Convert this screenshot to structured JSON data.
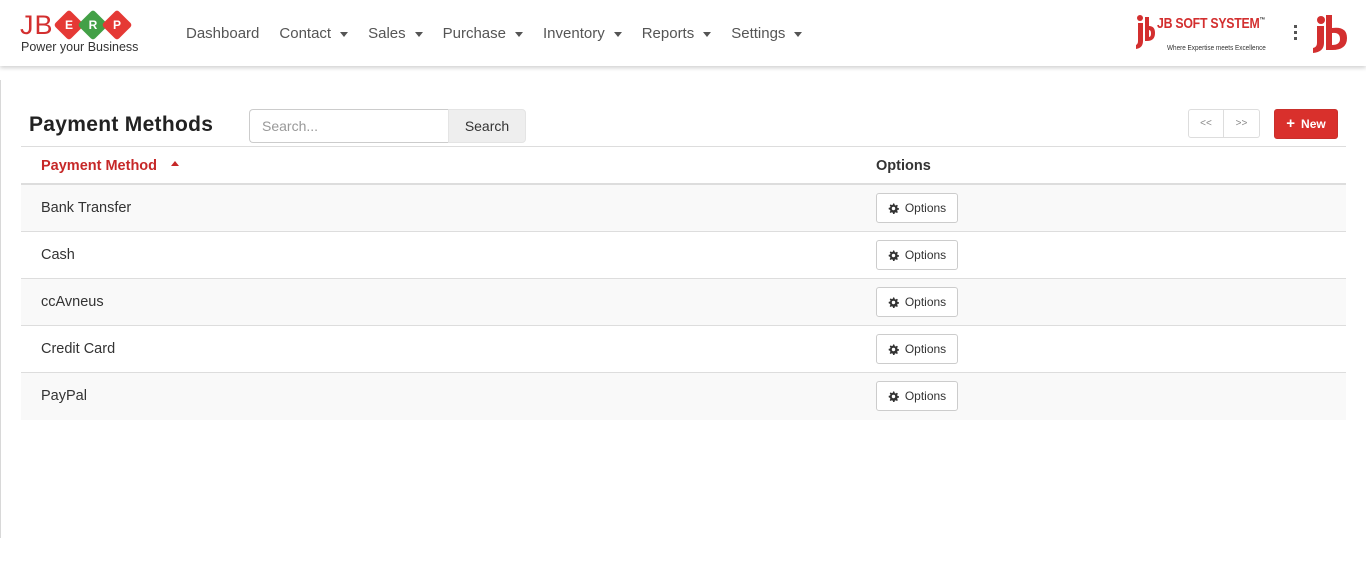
{
  "brand": {
    "name": "JB",
    "letters": [
      "E",
      "R",
      "P"
    ],
    "letter_colors": [
      "#1e88e5",
      "#43a047",
      "#e53935"
    ],
    "tagline": "Power your Business"
  },
  "nav": {
    "items": [
      {
        "label": "Dashboard",
        "dropdown": false
      },
      {
        "label": "Contact",
        "dropdown": true
      },
      {
        "label": "Sales",
        "dropdown": true
      },
      {
        "label": "Purchase",
        "dropdown": true
      },
      {
        "label": "Inventory",
        "dropdown": true
      },
      {
        "label": "Reports",
        "dropdown": true
      },
      {
        "label": "Settings",
        "dropdown": true
      }
    ]
  },
  "company": {
    "name": "JB SOFT SYSTEM",
    "tm": "™",
    "slogan": "Where Expertise meets Excellence"
  },
  "page": {
    "title": "Payment Methods",
    "search_placeholder": "Search...",
    "search_label": "Search",
    "prev_label": "<<",
    "next_label": ">>",
    "new_label": "New"
  },
  "table": {
    "columns": [
      "Payment Method",
      "Options"
    ],
    "sort": "ascending",
    "options_label": "Options",
    "rows": [
      "Bank Transfer",
      "Cash",
      "ccAvneus",
      "Credit Card",
      "PayPal"
    ]
  },
  "colors": {
    "accent": "#d9302c",
    "header_link": "#c62828"
  }
}
